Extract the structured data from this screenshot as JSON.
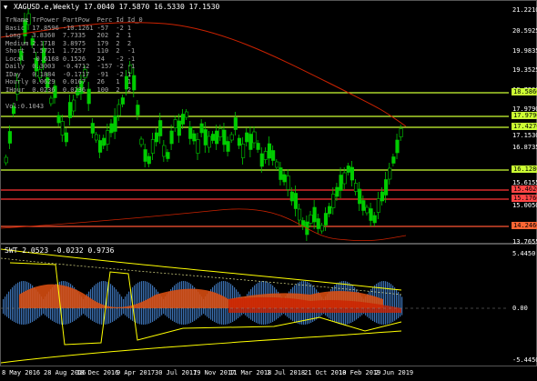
{
  "chart": {
    "title": "XAGUSD.e,Weekly  17.0040 17.5870 16.5330 17.1530",
    "right_axis_labels": [
      "21.2210",
      "20.5925",
      "19.9835",
      "19.3525",
      "18.7290",
      "17.9790",
      "17.1530",
      "16.8735",
      "16.1280",
      "15.6155",
      "15.0050",
      "14.3950",
      "13.7655"
    ],
    "level_tags": [
      {
        "label": "18.5860",
        "color": "#ccff33"
      },
      {
        "label": "17.9790",
        "color": "#ccff33"
      },
      {
        "label": "17.4270",
        "color": "#ccff33"
      },
      {
        "label": "16.1280",
        "color": "#ccff33"
      },
      {
        "label": "15.4620",
        "color": "#ff4444"
      },
      {
        "label": "15.1760",
        "color": "#ff4444"
      },
      {
        "label": "14.2460",
        "color": "#ff6633"
      }
    ],
    "current_price": "17.1530",
    "colors": {
      "bull": "#00cc00",
      "bear": "#00cc00",
      "ma": "#cc2200",
      "level_green": "#ccff33",
      "level_red": "#ff3333"
    }
  },
  "info_table": {
    "headers": [
      "TrName",
      "TrPower",
      "PartPow",
      "Perc",
      "Id",
      "Id_0"
    ],
    "rows": [
      [
        "Basic",
        "17.8596",
        "-10.1261",
        "-57",
        "-2",
        "1"
      ],
      [
        "Long",
        "3.8360",
        "7.7335",
        "202",
        "2",
        "1"
      ],
      [
        "Medium",
        "2.1718",
        "3.8975",
        "179",
        "2",
        "2"
      ],
      [
        "Short",
        "1.5721",
        "1.7257",
        "110",
        "2",
        "-1"
      ],
      [
        "Local",
        "-0.6168",
        "0.1526",
        "24",
        "-2",
        "-1"
      ],
      [
        "Daily",
        "0.3003",
        "-0.4712",
        "-157",
        "-2",
        "-1"
      ],
      [
        "IDay",
        "0.1884",
        "-0.1717",
        "-91",
        "-2",
        "1"
      ],
      [
        "Hourly",
        "0.0629",
        "0.0167",
        "26",
        "1",
        "1"
      ],
      [
        "IHour",
        "0.0236",
        "0.0236",
        "100",
        "2",
        "2"
      ]
    ],
    "footer": "Vol:0.1043"
  },
  "oscillator": {
    "title": "SWT  2.0523 -0.0232 0.9736",
    "axis_labels": [
      "5.4450",
      "0.00",
      "-5.4450"
    ]
  },
  "x_axis": [
    "8 May 2016",
    "28 Aug 2016",
    "18 Dec 2016",
    "9 Apr 2017",
    "30 Jul 2017",
    "19 Nov 2017",
    "11 Mar 2018",
    "1 Jul 2018",
    "21 Oct 2018",
    "10 Feb 2019",
    "2 Jun 2019"
  ]
}
